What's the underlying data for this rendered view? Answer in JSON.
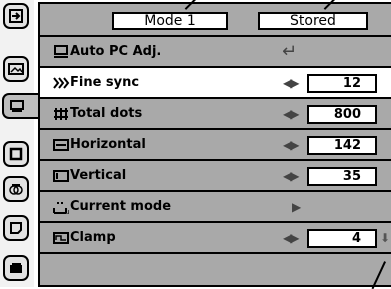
{
  "header": {
    "mode_label": "Mode 1",
    "stored_label": "Stored"
  },
  "rows": [
    {
      "label": "Auto PC Adj.",
      "icon": "auto-pc-icon",
      "control": "enter-icon"
    },
    {
      "label": "Fine sync",
      "icon": "fine-sync-icon",
      "value": "12",
      "selected": true
    },
    {
      "label": "Total dots",
      "icon": "total-dots-icon",
      "value": "800"
    },
    {
      "label": "Horizontal",
      "icon": "horizontal-icon",
      "value": "142"
    },
    {
      "label": "Vertical",
      "icon": "vertical-icon",
      "value": "35"
    },
    {
      "label": "Current mode",
      "icon": "current-mode-icon",
      "control": "triangle-right-icon"
    },
    {
      "label": "Clamp",
      "icon": "clamp-icon",
      "value": "4"
    }
  ],
  "sidebar": [
    "input-icon",
    "picture-icon",
    "pc-adjust-icon",
    "image-icon",
    "screen-icon",
    "setting-icon",
    "exit-icon"
  ],
  "colors": {
    "menu_bg": "#a9a9a9",
    "selected_bg": "#ffffff",
    "border": "#000000"
  }
}
